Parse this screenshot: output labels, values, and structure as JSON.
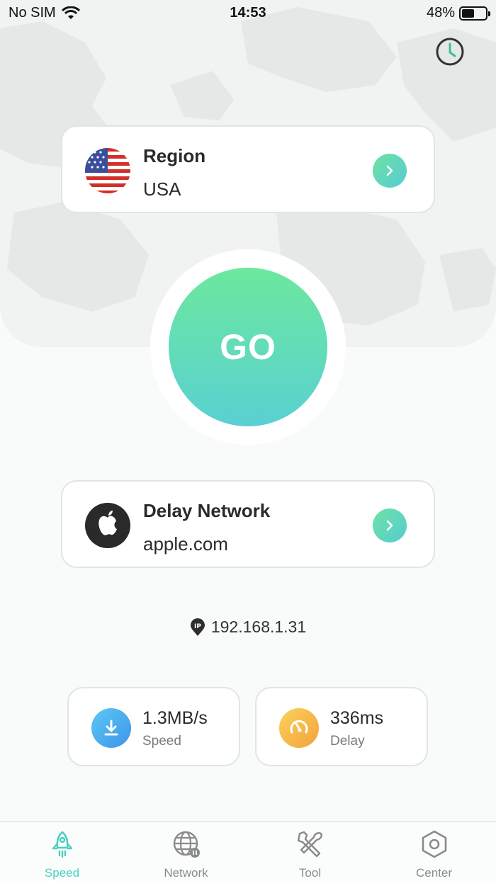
{
  "status_bar": {
    "carrier": "No SIM",
    "time": "14:53",
    "battery": "48%"
  },
  "region_card": {
    "title": "Region",
    "value": "USA"
  },
  "go_button": {
    "label": "GO"
  },
  "delay_card": {
    "title": "Delay Network",
    "value": "apple.com"
  },
  "ip_address": "192.168.1.31",
  "stats": {
    "speed": {
      "value": "1.3MB/s",
      "label": "Speed"
    },
    "delay": {
      "value": "336ms",
      "label": "Delay"
    }
  },
  "tabs": [
    {
      "label": "Speed",
      "icon": "rocket-icon",
      "active": true
    },
    {
      "label": "Network",
      "icon": "globe-icon",
      "active": false
    },
    {
      "label": "Tool",
      "icon": "tools-icon",
      "active": false
    },
    {
      "label": "Center",
      "icon": "hexagon-icon",
      "active": false
    }
  ],
  "colors": {
    "accent_start": "#6ce89e",
    "accent_end": "#5ad0d2",
    "active_tab": "#4ccfc0"
  }
}
